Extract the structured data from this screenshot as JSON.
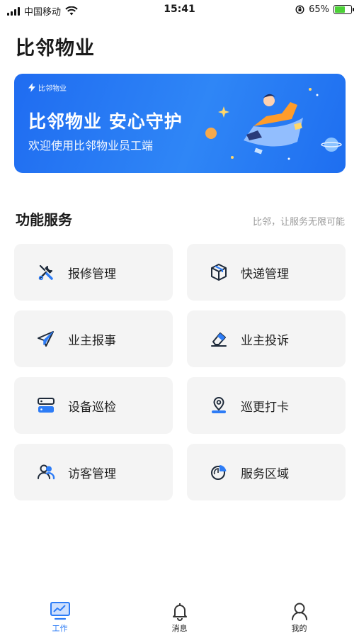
{
  "status_bar": {
    "carrier": "中国移动",
    "time": "15:41",
    "battery_pct": "65%",
    "battery_level": 0.65
  },
  "page_title": "比邻物业",
  "banner": {
    "logo_text": "比邻物业",
    "headline": "比邻物业 安心守护",
    "subtitle": "欢迎使用比邻物业员工端"
  },
  "services": {
    "title": "功能服务",
    "subtitle": "比邻，让服务无限可能",
    "items": [
      {
        "label": "报修管理",
        "icon": "wrench-screwdriver-icon"
      },
      {
        "label": "快递管理",
        "icon": "package-box-icon"
      },
      {
        "label": "业主报事",
        "icon": "paper-plane-icon"
      },
      {
        "label": "业主投诉",
        "icon": "eraser-icon"
      },
      {
        "label": "设备巡检",
        "icon": "server-icon"
      },
      {
        "label": "巡更打卡",
        "icon": "location-pin-icon"
      },
      {
        "label": "访客管理",
        "icon": "users-icon"
      },
      {
        "label": "服务区域",
        "icon": "pie-chart-icon"
      }
    ]
  },
  "tab_bar": {
    "active": "工作",
    "items": [
      {
        "label": "工作",
        "icon": "monitor-chart-icon"
      },
      {
        "label": "消息",
        "icon": "bell-icon"
      },
      {
        "label": "我的",
        "icon": "user-profile-icon"
      }
    ]
  },
  "colors": {
    "accent": "#2d7cf6",
    "icon_blue": "#2d7cf6",
    "icon_dark": "#1e2a3a",
    "card_bg": "#f4f4f4"
  }
}
